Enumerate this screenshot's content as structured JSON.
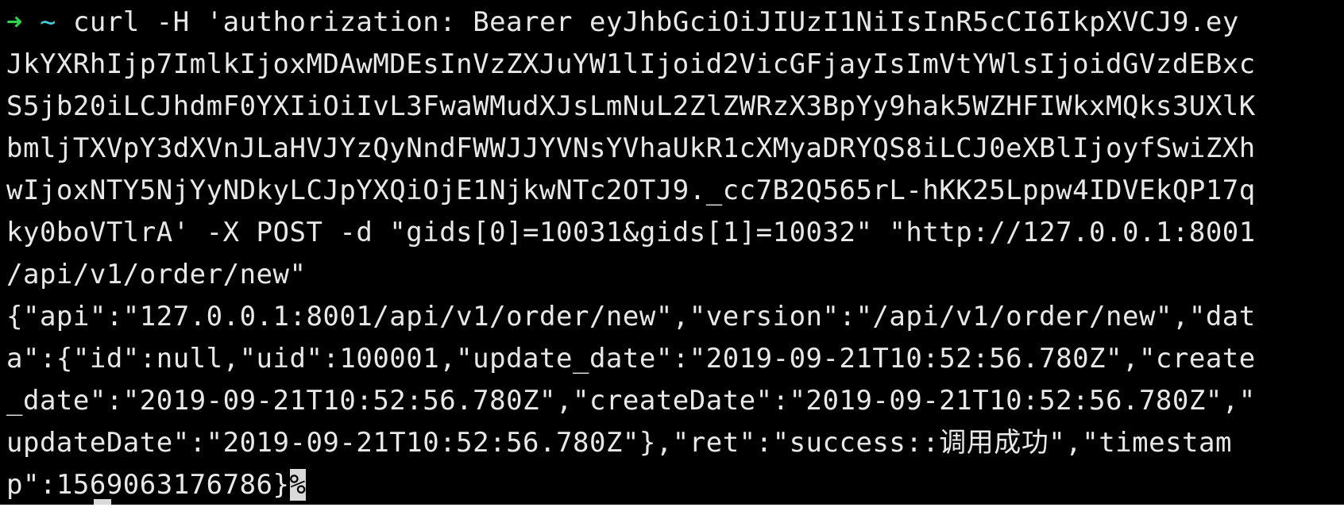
{
  "terminal": {
    "prompt": {
      "arrow": "➜",
      "tilde": "~"
    },
    "command_first_line": "curl -H 'authorization: Bearer eyJhbGciOiJIUzI1NiIsInR5cCI6IkpXVCJ9.ey",
    "lines": [
      "JkYXRhIjp7ImlkIjoxMDAwMDEsInVzZXJuYW1lIjoid2VicGFjayIsImVtYWlsIjoidGVzdEBxc",
      "S5jb20iLCJhdmF0YXIiOiIvL3FwaWMudXJsLmNuL2ZlZWRzX3BpYy9hak5WZHFIWkxMQks3UXlK",
      "bmljTXVpY3dXVnJLaHVJYzQyNndFWWJJYVNsYVhaUkR1cXMyaDRYQS8iLCJ0eXBlIjoyfSwiZXh",
      "wIjoxNTY5NjYyNDkyLCJpYXQiOjE1NjkwNTc2OTJ9._cc7B2Q565rL-hKK25Lppw4IDVEkQP17q",
      "ky0boVTlrA' -X POST -d \"gids[0]=10031&gids[1]=10032\" \"http://127.0.0.1:8001",
      "/api/v1/order/new\"",
      "{\"api\":\"127.0.0.1:8001/api/v1/order/new\",\"version\":\"/api/v1/order/new\",\"dat",
      "a\":{\"id\":null,\"uid\":100001,\"update_date\":\"2019-09-21T10:52:56.780Z\",\"create",
      "_date\":\"2019-09-21T10:52:56.780Z\",\"createDate\":\"2019-09-21T10:52:56.780Z\",\"",
      "updateDate\":\"2019-09-21T10:52:56.780Z\"},\"ret\":\"success::调用成功\",\"timestam"
    ],
    "last_line": "p\":1569063176786}",
    "end_marker": "%"
  }
}
